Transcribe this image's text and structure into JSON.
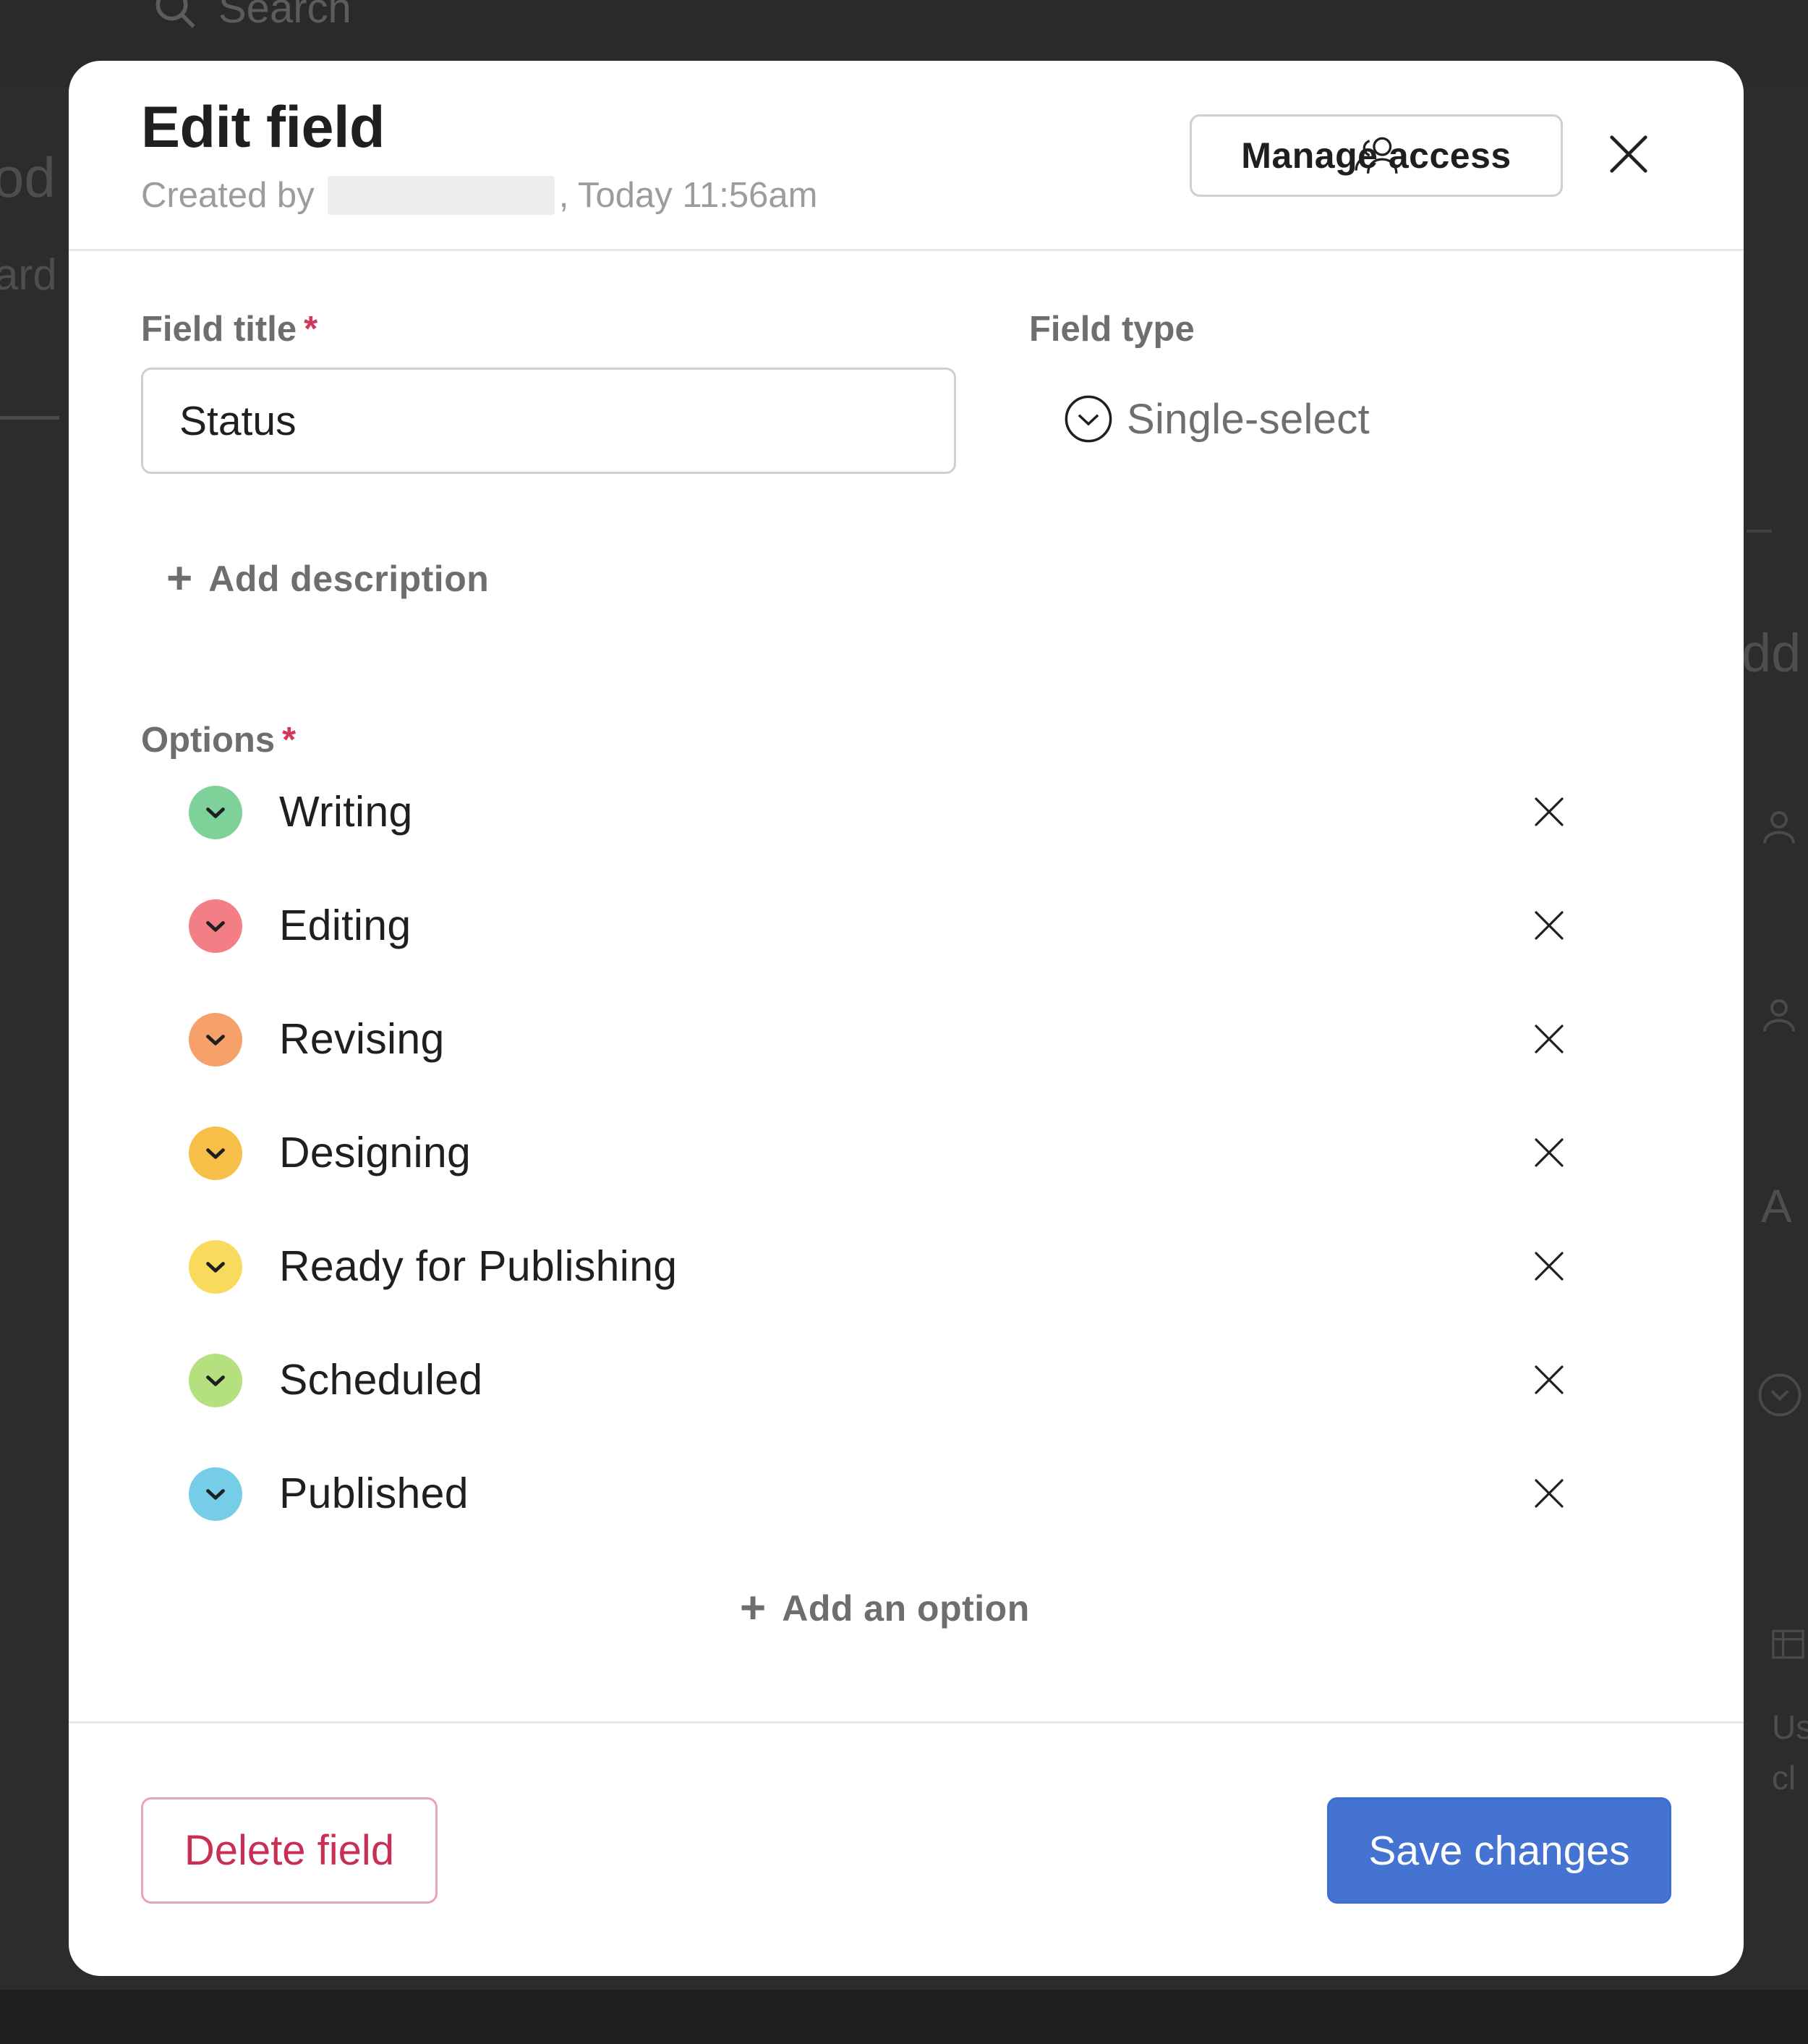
{
  "background": {
    "search_label": "Search",
    "fragment_left_1": "od",
    "fragment_left_2": "ard",
    "fragment_right_1": "dd",
    "fragment_right_2": "A",
    "fragment_right_3": "Us",
    "fragment_right_4": "cl"
  },
  "modal": {
    "title": "Edit field",
    "created_by_label": "Created by",
    "created_time": ", Today 11:56am",
    "manage_access_label": "Manage access",
    "close_label": "Close"
  },
  "form": {
    "field_title_label": "Field title",
    "required_marker": "*",
    "field_title_value": "Status",
    "field_type_label": "Field type",
    "field_type_value": "Single-select",
    "add_description_label": "Add description",
    "options_label": "Options",
    "add_option_label": "Add an option"
  },
  "options": [
    {
      "label": "Writing",
      "color": "#7fd19a"
    },
    {
      "label": "Editing",
      "color": "#f47e86"
    },
    {
      "label": "Revising",
      "color": "#f6a16a"
    },
    {
      "label": "Designing",
      "color": "#f8bf48"
    },
    {
      "label": "Ready for Publishing",
      "color": "#f8da5c"
    },
    {
      "label": "Scheduled",
      "color": "#b4e07e"
    },
    {
      "label": "Published",
      "color": "#76cde8"
    }
  ],
  "footer": {
    "delete_label": "Delete field",
    "save_label": "Save changes"
  },
  "icons": {
    "manage_access": "people-icon",
    "close": "close-icon",
    "field_type": "chevron-circle-icon",
    "option_dot": "chevron-down-icon",
    "remove_option": "x-icon"
  },
  "colors": {
    "accent": "#4573d2",
    "danger": "#c92f52",
    "required": "#d1395b"
  }
}
